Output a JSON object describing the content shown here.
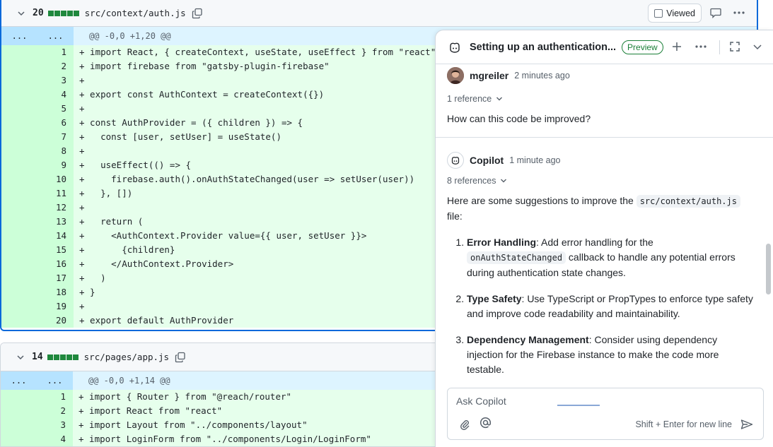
{
  "file1": {
    "change_count": "20",
    "filename": "src/context/auth.js",
    "viewed_label": "Viewed",
    "hunk_left": "...",
    "hunk_right": "...",
    "hunk_header": "@@ -0,0 +1,20 @@",
    "lines": [
      {
        "n": "1",
        "code": "+ import React, { createContext, useState, useEffect } from \"react\""
      },
      {
        "n": "2",
        "code": "+ import firebase from \"gatsby-plugin-firebase\""
      },
      {
        "n": "3",
        "code": "+"
      },
      {
        "n": "4",
        "code": "+ export const AuthContext = createContext({})"
      },
      {
        "n": "5",
        "code": "+"
      },
      {
        "n": "6",
        "code": "+ const AuthProvider = ({ children }) => {"
      },
      {
        "n": "7",
        "code": "+   const [user, setUser] = useState()"
      },
      {
        "n": "8",
        "code": "+"
      },
      {
        "n": "9",
        "code": "+   useEffect(() => {"
      },
      {
        "n": "10",
        "code": "+     firebase.auth().onAuthStateChanged(user => setUser(user))"
      },
      {
        "n": "11",
        "code": "+   }, [])"
      },
      {
        "n": "12",
        "code": "+"
      },
      {
        "n": "13",
        "code": "+   return ("
      },
      {
        "n": "14",
        "code": "+     <AuthContext.Provider value={{ user, setUser }}>"
      },
      {
        "n": "15",
        "code": "+       {children}"
      },
      {
        "n": "16",
        "code": "+     </AuthContext.Provider>"
      },
      {
        "n": "17",
        "code": "+   )"
      },
      {
        "n": "18",
        "code": "+ }"
      },
      {
        "n": "19",
        "code": "+"
      },
      {
        "n": "20",
        "code": "+ export default AuthProvider"
      }
    ]
  },
  "file2": {
    "change_count": "14",
    "filename": "src/pages/app.js",
    "hunk_left": "...",
    "hunk_right": "...",
    "hunk_header": "@@ -0,0 +1,14 @@",
    "lines": [
      {
        "n": "1",
        "code": "+ import { Router } from \"@reach/router\""
      },
      {
        "n": "2",
        "code": "+ import React from \"react\""
      },
      {
        "n": "3",
        "code": "+ import Layout from \"../components/layout\""
      },
      {
        "n": "4",
        "code": "+ import LoginForm from \"../components/Login/LoginForm\""
      }
    ]
  },
  "copilot": {
    "title": "Setting up an authentication...",
    "badge": "Preview",
    "user_msg": {
      "author": "mgreiler",
      "time": "2 minutes ago",
      "refs": "1 reference",
      "text": "How can this code be improved?"
    },
    "bot_msg": {
      "author": "Copilot",
      "time": "1 minute ago",
      "refs": "8 references",
      "intro_before": "Here are some suggestions to improve the ",
      "intro_code": "src/context/auth.js",
      "intro_after": "file:",
      "items": [
        {
          "title": "Error Handling",
          "pre": ": Add error handling for the ",
          "code": "onAuthStateChanged",
          "post": " callback to handle any potential errors during authentication state changes."
        },
        {
          "title": "Type Safety",
          "pre": ": Use TypeScript or PropTypes to enforce type safety and improve code readability and maintainability.",
          "code": "",
          "post": ""
        },
        {
          "title": "Dependency Management",
          "pre": ": Consider using dependency injection for the Firebase instance to make the code more testable.",
          "code": "",
          "post": ""
        }
      ]
    },
    "composer": {
      "placeholder": "Ask Copilot",
      "hint": "Shift + Enter for new line"
    }
  }
}
